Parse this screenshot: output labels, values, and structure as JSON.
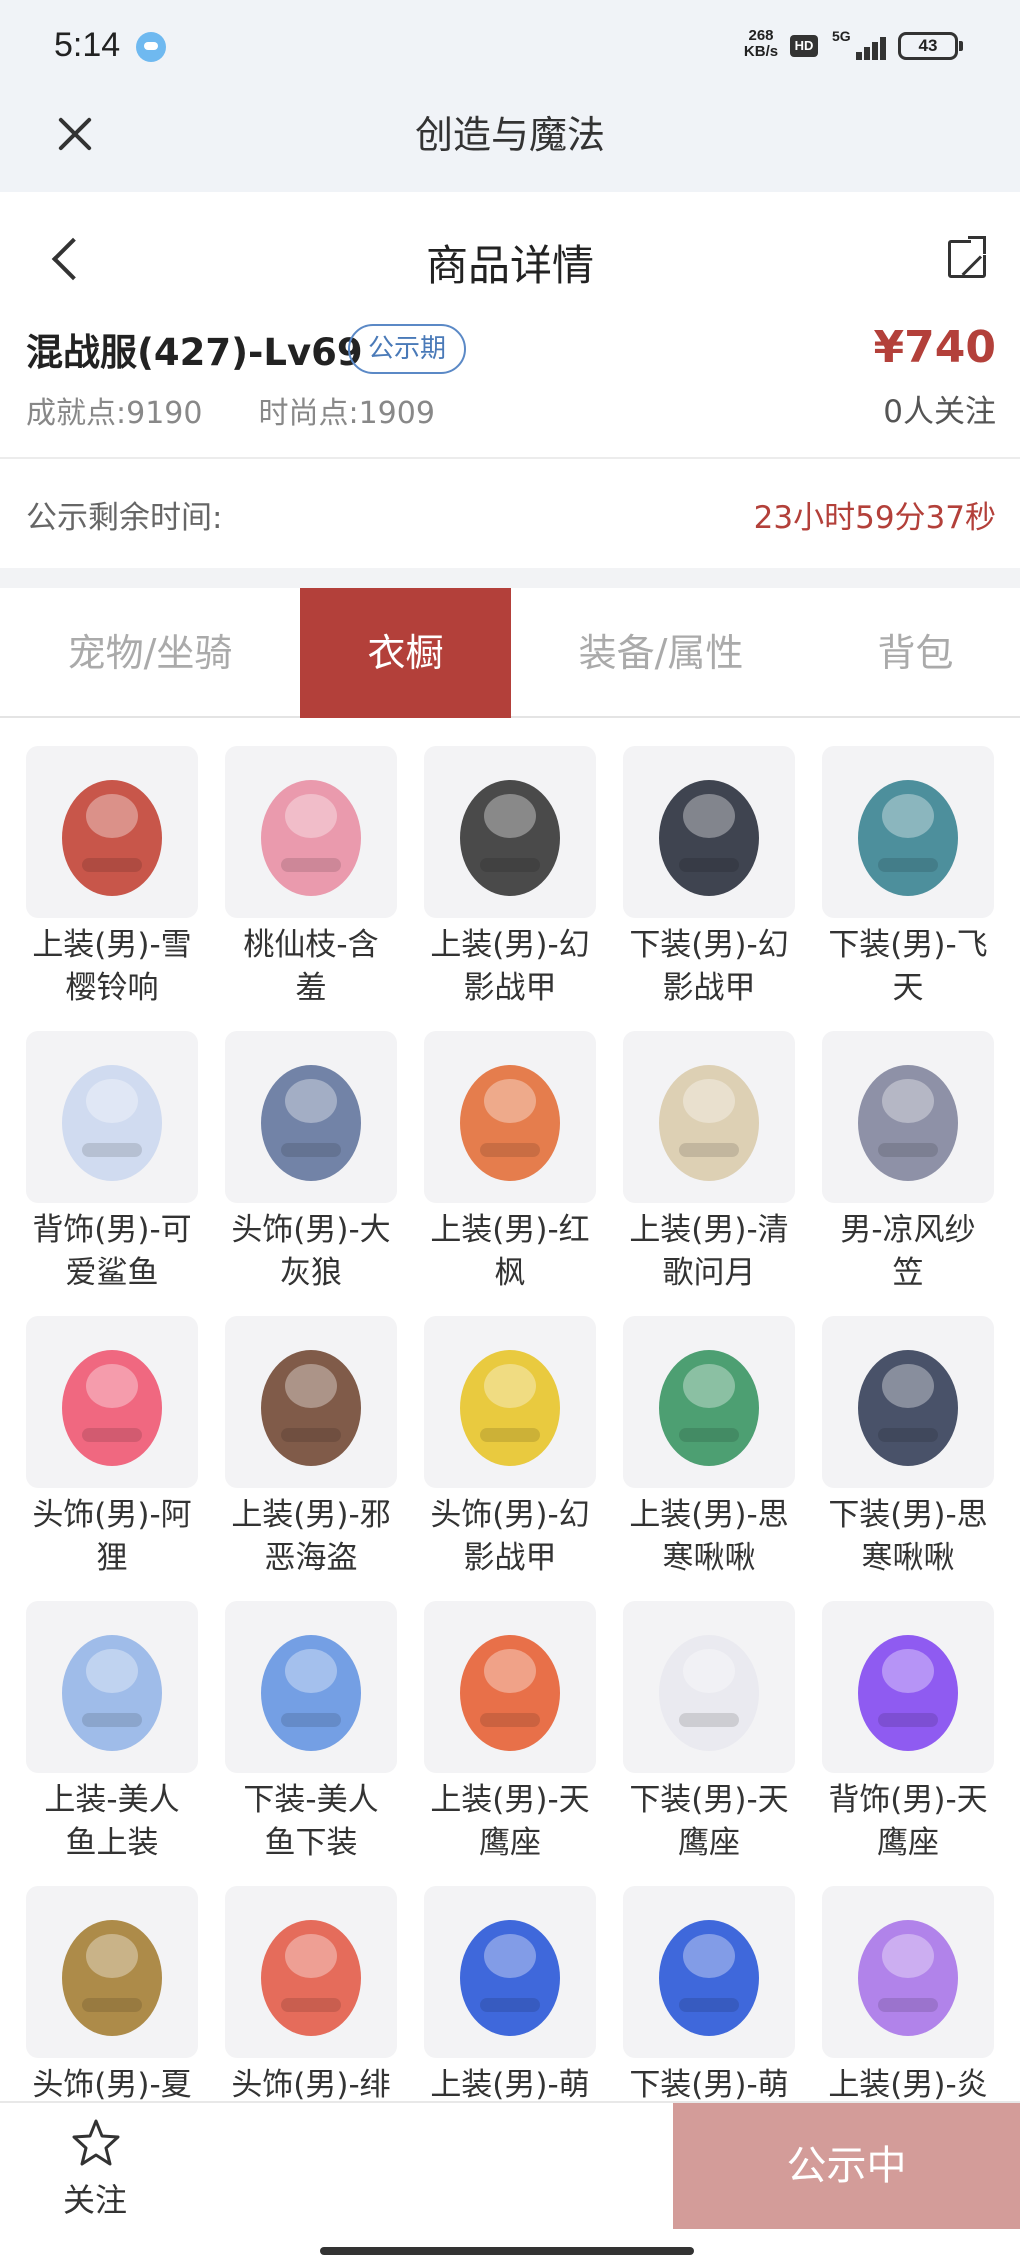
{
  "status_bar": {
    "time": "5:14",
    "net_speed_top": "268",
    "net_speed_bottom": "KB/s",
    "hd": "HD",
    "network": "5G",
    "battery": "43"
  },
  "app_bar": {
    "title": "创造与魔法"
  },
  "nav": {
    "title": "商品详情"
  },
  "product": {
    "server_name": "混战服(427)-Lv69",
    "tag": "公示期",
    "price": "¥740",
    "achievement_label": "成就点:",
    "achievement_value": "9190",
    "fashion_label": "时尚点:",
    "fashion_value": "1909",
    "followers": "0人关注"
  },
  "countdown": {
    "label": "公示剩余时间:",
    "value": "23小时59分37秒"
  },
  "tabs": [
    {
      "label": "宠物/坐骑",
      "active": false
    },
    {
      "label": "衣橱",
      "active": true
    },
    {
      "label": "装备/属性",
      "active": false
    },
    {
      "label": "背包",
      "active": false
    }
  ],
  "items": [
    {
      "line1": "上装(男)-雪",
      "line2": "樱铃响",
      "icon": "snow-bell-top-icon",
      "color": "#c0392b"
    },
    {
      "line1": "桃仙枝-含",
      "line2": "羞",
      "icon": "peach-branch-icon",
      "color": "#e88aa0"
    },
    {
      "line1": "上装(男)-幻",
      "line2": "影战甲",
      "icon": "phantom-armor-top-icon",
      "color": "#2b2b2b"
    },
    {
      "line1": "下装(男)-幻",
      "line2": "影战甲",
      "icon": "phantom-armor-pants-icon",
      "color": "#1f2533"
    },
    {
      "line1": "下装(男)-飞",
      "line2": "天",
      "icon": "feitian-pants-icon",
      "color": "#2f7d8c"
    },
    {
      "line1": "背饰(男)-可",
      "line2": "爱鲨鱼",
      "icon": "shark-back-icon",
      "color": "#c9d6ee"
    },
    {
      "line1": "头饰(男)-大",
      "line2": "灰狼",
      "icon": "grey-wolf-hat-icon",
      "color": "#5b6f99"
    },
    {
      "line1": "上装(男)-红",
      "line2": "枫",
      "icon": "red-maple-top-icon",
      "color": "#e2672f"
    },
    {
      "line1": "上装(男)-清",
      "line2": "歌问月",
      "icon": "moon-song-top-icon",
      "color": "#d8c9a8"
    },
    {
      "line1": "男-凉风纱",
      "line2": "笠",
      "icon": "gauze-hat-icon",
      "color": "#7b7f99"
    },
    {
      "line1": "头饰(男)-阿",
      "line2": "狸",
      "icon": "ali-fox-head-icon",
      "color": "#ef4f6b"
    },
    {
      "line1": "上装(男)-邪",
      "line2": "恶海盗",
      "icon": "pirate-coat-icon",
      "color": "#6b3f2a"
    },
    {
      "line1": "头饰(男)-幻",
      "line2": "影战甲",
      "icon": "phantom-helmet-icon",
      "color": "#e6c21e"
    },
    {
      "line1": "上装(男)-思",
      "line2": "寒啾啾",
      "icon": "green-hoodie-icon",
      "color": "#2f8f5b"
    },
    {
      "line1": "下装(男)-思",
      "line2": "寒啾啾",
      "icon": "denim-pants-icon",
      "color": "#2a3550"
    },
    {
      "line1": "上装-美人",
      "line2": "鱼上装",
      "icon": "mermaid-top-icon",
      "color": "#8fb1e6"
    },
    {
      "line1": "下装-美人",
      "line2": "鱼下装",
      "icon": "mermaid-skirt-icon",
      "color": "#5d8fe0"
    },
    {
      "line1": "上装(男)-天",
      "line2": "鹰座",
      "icon": "aquila-jacket-icon",
      "color": "#e5582a"
    },
    {
      "line1": "下装(男)-天",
      "line2": "鹰座",
      "icon": "aquila-pants-icon",
      "color": "#e8e8ee"
    },
    {
      "line1": "背饰(男)-天",
      "line2": "鹰座",
      "icon": "aquila-backpack-icon",
      "color": "#7d3ff0"
    },
    {
      "line1": "头饰(男)-夏",
      "line2": "",
      "icon": "summer-hat-icon",
      "color": "#a0782a"
    },
    {
      "line1": "头饰(男)-绯",
      "line2": "",
      "icon": "crimson-fox-ears-icon",
      "color": "#e2543f"
    },
    {
      "line1": "上装(男)-萌",
      "line2": "",
      "icon": "cute-robe-icon",
      "color": "#1f4fd6"
    },
    {
      "line1": "下装(男)-萌",
      "line2": "",
      "icon": "cute-pants-icon",
      "color": "#1f4fd6"
    },
    {
      "line1": "上装(男)-炎",
      "line2": "",
      "icon": "flower-lei-icon",
      "color": "#a56fe8"
    }
  ],
  "bottom": {
    "follow_label": "关注",
    "status_button": "公示中"
  }
}
